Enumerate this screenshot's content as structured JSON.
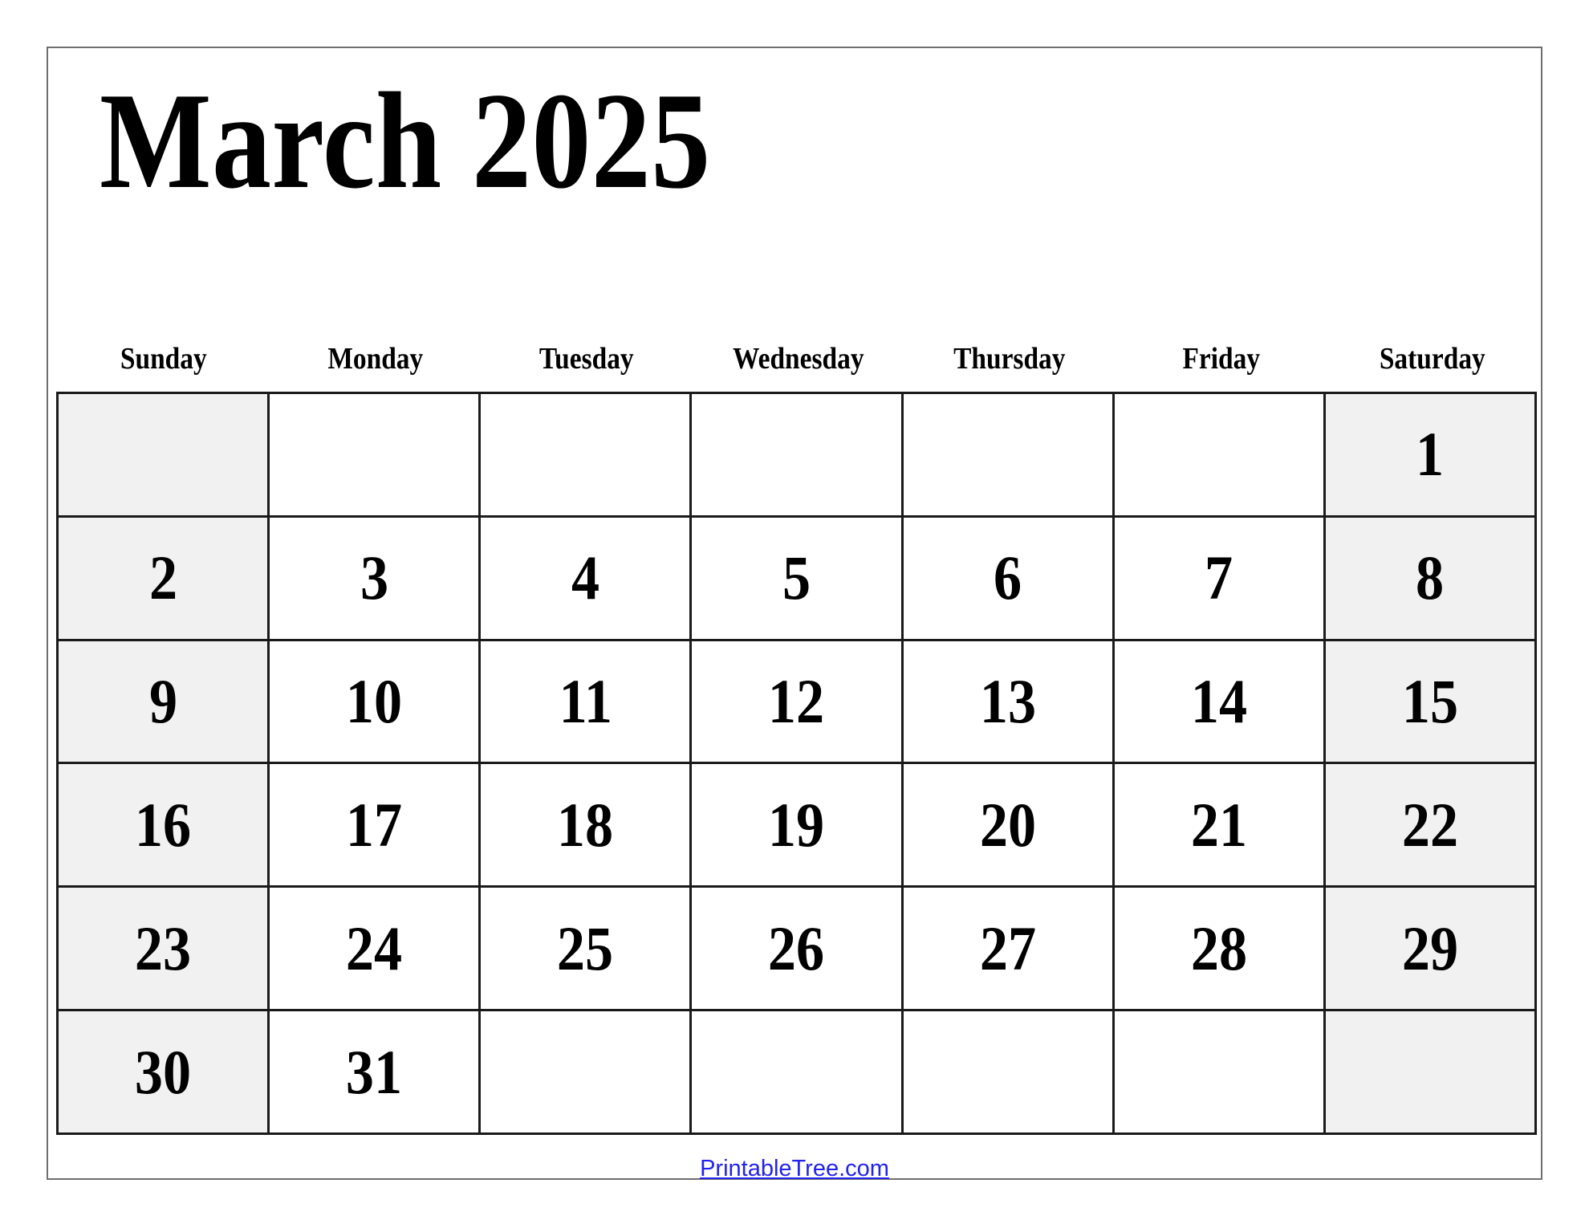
{
  "page": {
    "title": "March 2025",
    "month": "March",
    "year": "2025",
    "background_color": "#ffffff",
    "frame_border_color": "#6e6e6e",
    "grid_line_color": "#1a1a1a",
    "weekend_shade_color": "#f1f1f1",
    "link_color": "#2222ee"
  },
  "weekdays": [
    {
      "label": "Sunday"
    },
    {
      "label": "Monday"
    },
    {
      "label": "Tuesday"
    },
    {
      "label": "Wednesday"
    },
    {
      "label": "Thursday"
    },
    {
      "label": "Friday"
    },
    {
      "label": "Saturday"
    }
  ],
  "weeks": [
    [
      {
        "day": "",
        "shaded": true
      },
      {
        "day": "",
        "shaded": false
      },
      {
        "day": "",
        "shaded": false
      },
      {
        "day": "",
        "shaded": false
      },
      {
        "day": "",
        "shaded": false
      },
      {
        "day": "",
        "shaded": false
      },
      {
        "day": "1",
        "shaded": true
      }
    ],
    [
      {
        "day": "2",
        "shaded": true
      },
      {
        "day": "3",
        "shaded": false
      },
      {
        "day": "4",
        "shaded": false
      },
      {
        "day": "5",
        "shaded": false
      },
      {
        "day": "6",
        "shaded": false
      },
      {
        "day": "7",
        "shaded": false
      },
      {
        "day": "8",
        "shaded": true
      }
    ],
    [
      {
        "day": "9",
        "shaded": true
      },
      {
        "day": "10",
        "shaded": false
      },
      {
        "day": "11",
        "shaded": false
      },
      {
        "day": "12",
        "shaded": false
      },
      {
        "day": "13",
        "shaded": false
      },
      {
        "day": "14",
        "shaded": false
      },
      {
        "day": "15",
        "shaded": true
      }
    ],
    [
      {
        "day": "16",
        "shaded": true
      },
      {
        "day": "17",
        "shaded": false
      },
      {
        "day": "18",
        "shaded": false
      },
      {
        "day": "19",
        "shaded": false
      },
      {
        "day": "20",
        "shaded": false
      },
      {
        "day": "21",
        "shaded": false
      },
      {
        "day": "22",
        "shaded": true
      }
    ],
    [
      {
        "day": "23",
        "shaded": true
      },
      {
        "day": "24",
        "shaded": false
      },
      {
        "day": "25",
        "shaded": false
      },
      {
        "day": "26",
        "shaded": false
      },
      {
        "day": "27",
        "shaded": false
      },
      {
        "day": "28",
        "shaded": false
      },
      {
        "day": "29",
        "shaded": true
      }
    ],
    [
      {
        "day": "30",
        "shaded": true
      },
      {
        "day": "31",
        "shaded": false
      },
      {
        "day": "",
        "shaded": false
      },
      {
        "day": "",
        "shaded": false
      },
      {
        "day": "",
        "shaded": false
      },
      {
        "day": "",
        "shaded": false
      },
      {
        "day": "",
        "shaded": true
      }
    ]
  ],
  "footer": {
    "link_label": "PrintableTree.com"
  }
}
